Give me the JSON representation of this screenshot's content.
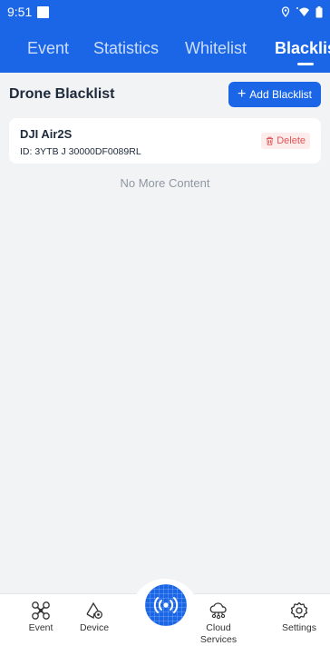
{
  "status_bar": {
    "time": "9:51",
    "icons": [
      "location-icon",
      "wifi-icon",
      "battery-icon"
    ]
  },
  "tabs": [
    {
      "label": "Event",
      "active": false
    },
    {
      "label": "Statistics",
      "active": false
    },
    {
      "label": "Whitelist",
      "active": false
    },
    {
      "label": "Blacklis",
      "active": true
    }
  ],
  "section": {
    "title": "Drone Blacklist",
    "add_button": "Add Blacklist"
  },
  "blacklist": [
    {
      "name": "DJI Air2S",
      "id": "ID: 3YTB J 30000DF0089RL",
      "delete_label": "Delete"
    }
  ],
  "list_footer": "No More Content",
  "bottom_nav": {
    "items": [
      {
        "label": "Event",
        "icon": "drone-icon"
      },
      {
        "label": "Device",
        "icon": "device-icon"
      },
      {
        "label": "Cloud Services",
        "icon": "cloud-icon"
      },
      {
        "label": "Settings",
        "icon": "settings-icon"
      }
    ],
    "center_icon": "signal-broadcast-icon"
  },
  "colors": {
    "primary": "#1a66e6",
    "delete": "#e05555",
    "background": "#f2f3f5"
  }
}
